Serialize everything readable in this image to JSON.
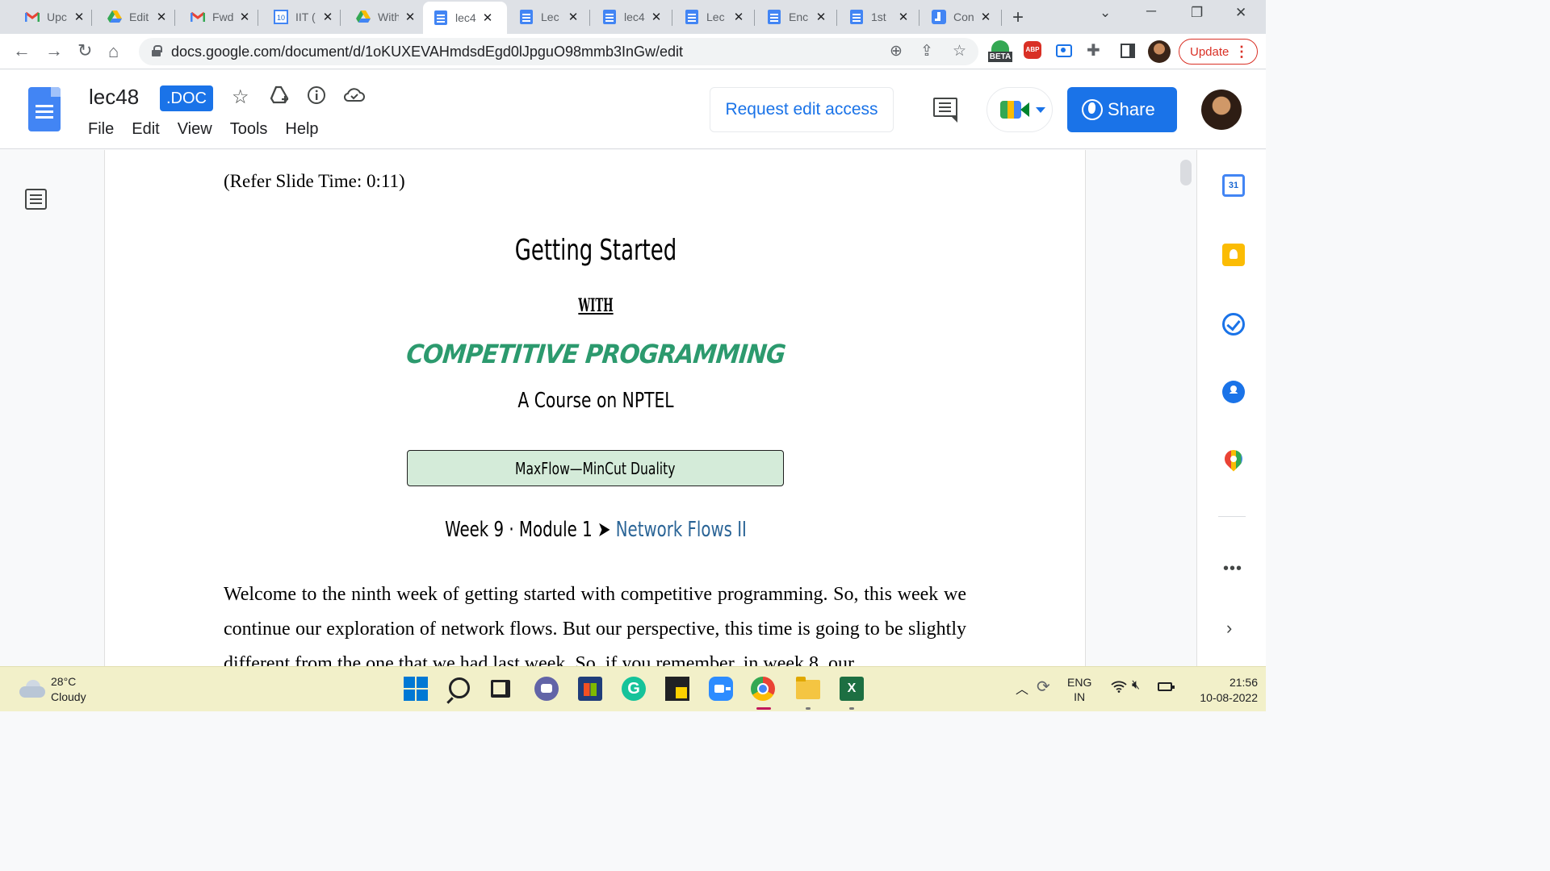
{
  "browser": {
    "tabs": [
      {
        "title": "Upc",
        "icon": "gmail-icon"
      },
      {
        "title": "Edit",
        "icon": "drive-icon"
      },
      {
        "title": "Fwd",
        "icon": "gmail-icon"
      },
      {
        "title": "IIT (",
        "icon": "calendar-icon"
      },
      {
        "title": "With",
        "icon": "drive-icon"
      },
      {
        "title": "lec4",
        "icon": "docs-icon",
        "active": true
      },
      {
        "title": "Lec",
        "icon": "docs-icon"
      },
      {
        "title": "lec4",
        "icon": "docs-icon"
      },
      {
        "title": "Lec",
        "icon": "docs-icon"
      },
      {
        "title": "Enc",
        "icon": "docs-icon"
      },
      {
        "title": "1st",
        "icon": "docs-icon"
      },
      {
        "title": "Con",
        "icon": "jamboard-icon"
      }
    ],
    "new_tab": "+",
    "url": "docs.google.com/document/d/1oKUXEVAHmdsdEgd0lJpguO98mmb3InGw/edit",
    "extension_beta_label": "BETA",
    "extension_abp_label": "ABP",
    "update_label": "Update"
  },
  "docs": {
    "title": "lec48",
    "badge": ".DOC",
    "menu": [
      "File",
      "Edit",
      "View",
      "Tools",
      "Help"
    ],
    "request_edit_label": "Request edit access",
    "share_label": "Share",
    "accent_color": "#1a73e8"
  },
  "document": {
    "refer_line": "(Refer Slide Time: 0:11)",
    "slide_title": "Getting Started",
    "slide_with": "WITH",
    "slide_brand": "COMPETITIVE PROGRAMMING",
    "slide_course": "A Course on NPTEL",
    "slide_topic": "MaxFlow—MinCut Duality",
    "week_prefix": "Week 9 · Module 1 ➤ ",
    "week_topic": "Network Flows II",
    "paragraph": "Welcome to the ninth week of getting started with competitive programming. So, this week we continue our exploration of network flows. But our perspective, this time is going to be slightly different from the one that we had last week. So, if you remember, in week 8, our",
    "brand_color": "#2c9a6e",
    "topic_box_color": "#d4ebd9"
  },
  "side_panel": {
    "calendar_day": "31",
    "more": "•••",
    "expand": "›"
  },
  "taskbar": {
    "weather_temp": "28°C",
    "weather_desc": "Cloudy",
    "grammarly_letter": "G",
    "excel_letter": "X",
    "lang_line1": "ENG",
    "lang_line2": "IN",
    "time": "21:56",
    "date": "10-08-2022",
    "bg_color": "#f2f0c9"
  }
}
